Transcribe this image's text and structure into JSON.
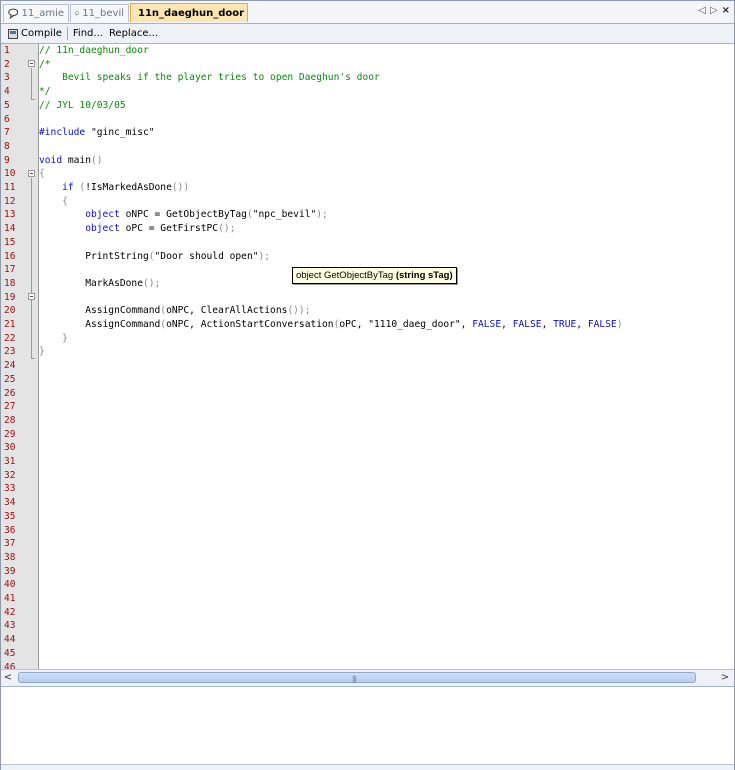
{
  "tabs": [
    {
      "label": "11_amie",
      "icon": "speech-bubble-icon"
    },
    {
      "label": "11_bevil",
      "icon": "speech-bubble-icon"
    },
    {
      "label": "11n_daeghun_door",
      "icon": "script-icon",
      "active": true
    }
  ],
  "tab_nav": {
    "prev": "◁",
    "next": "▷",
    "close": "×"
  },
  "toolbar": {
    "compile": "Compile",
    "find": "Find...",
    "replace": "Replace..."
  },
  "line_numbers": [
    "1",
    "2",
    "3",
    "4",
    "5",
    "6",
    "7",
    "8",
    "9",
    "10",
    "11",
    "12",
    "13",
    "14",
    "15",
    "16",
    "17",
    "18",
    "19",
    "20",
    "21",
    "22",
    "23",
    "24",
    "25",
    "26",
    "27",
    "28",
    "29",
    "30",
    "31",
    "32",
    "33",
    "34",
    "35",
    "36",
    "37",
    "38",
    "39",
    "40",
    "41",
    "42",
    "43",
    "44",
    "45",
    "46"
  ],
  "code": {
    "l1": "// 11n_daeghun_door",
    "l2": "/*",
    "l3": "    Bevil speaks if the player tries to open Daeghun's door",
    "l4": "*/",
    "l5": "// JYL 10/03/05",
    "l7a": "#include",
    "l7b": " \"ginc_misc\"",
    "l9a": "void",
    "l9b": " main",
    "l9c": "()",
    "l10": "{",
    "l11a": "    if",
    "l11b": " (",
    "l11c": "!IsMarkedAsDone",
    "l11d": "())",
    "l12": "    {",
    "l13a": "        object",
    "l13b": " oNPC = GetObjectByTag",
    "l13c": "(",
    "l13d": "\"npc_bevil\"",
    "l13e": ");",
    "l14a": "        object",
    "l14b": " oPC = GetFirstPC",
    "l14c": "();",
    "l16a": "        PrintString",
    "l16b": "(",
    "l16c": "\"Door should open\"",
    "l16d": ");",
    "l18a": "        MarkAsDone",
    "l18b": "();",
    "l20a": "        AssignCommand",
    "l20b": "(",
    "l20c": "oNPC, ClearAllActions",
    "l20d": "());",
    "l21a": "        AssignCommand",
    "l21b": "(",
    "l21c": "oNPC, ActionStartConversation",
    "l21d": "(",
    "l21e": "oPC, \"1110_daeg_door\", ",
    "l21f": "FALSE",
    "l21g": ", ",
    "l21h": "FALSE",
    "l21i": ", ",
    "l21j": "TRUE",
    "l21k": ", ",
    "l21l": "FALSE",
    "l21m": ")",
    "l22": "    }",
    "l23": "}"
  },
  "tooltip": {
    "signature": "object GetObjectByTag",
    "params": "(string sTag)"
  },
  "scrollbar": {
    "left": "<",
    "right": ">",
    "grip": "|||"
  },
  "colors": {
    "comment": "#0a8a0a",
    "keyword": "#1010c0",
    "line_number": "#a01010",
    "active_tab": "#fde6b3"
  }
}
